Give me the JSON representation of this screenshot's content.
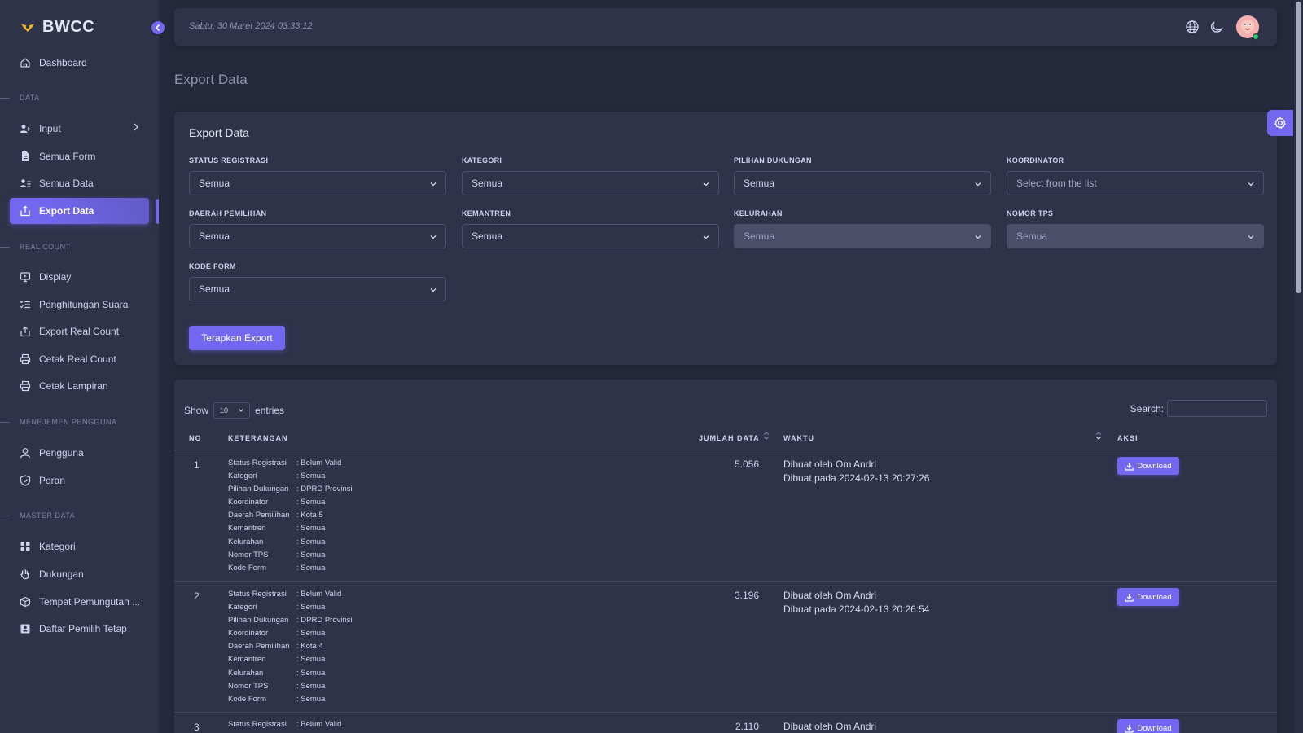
{
  "brand": {
    "name": "BWCC"
  },
  "sidebar": {
    "items": [
      {
        "label": "Dashboard",
        "icon": "home-icon"
      },
      {
        "label": "Input",
        "icon": "user-plus-icon"
      },
      {
        "label": "Semua Form",
        "icon": "file-icon"
      },
      {
        "label": "Semua Data",
        "icon": "users-list-icon"
      },
      {
        "label": "Export Data",
        "icon": "export-icon"
      },
      {
        "label": "Display",
        "icon": "monitor-icon"
      },
      {
        "label": "Penghitungan Suara",
        "icon": "list-check-icon"
      },
      {
        "label": "Export Real Count",
        "icon": "export-icon"
      },
      {
        "label": "Cetak Real Count",
        "icon": "printer-icon"
      },
      {
        "label": "Cetak Lampiran",
        "icon": "printer-icon"
      },
      {
        "label": "Pengguna",
        "icon": "user-icon"
      },
      {
        "label": "Peran",
        "icon": "shield-icon"
      },
      {
        "label": "Kategori",
        "icon": "grid-icon"
      },
      {
        "label": "Dukungan",
        "icon": "hand-icon"
      },
      {
        "label": "Tempat Pemungutan ...",
        "icon": "box-icon"
      },
      {
        "label": "Daftar Pemilih Tetap",
        "icon": "id-card-icon"
      }
    ],
    "sections": [
      "DATA",
      "REAL COUNT",
      "MENEJEMEN PENGGUNA",
      "MASTER DATA"
    ]
  },
  "topbar": {
    "datetime": "Sabtu, 30 Maret 2024  03:33:12"
  },
  "page": {
    "title": "Export Data"
  },
  "filter": {
    "title": "Export Data",
    "fields": [
      {
        "label": "STATUS REGISTRASI",
        "value": "Semua"
      },
      {
        "label": "KATEGORI",
        "value": "Semua"
      },
      {
        "label": "PILIHAN DUKUNGAN",
        "value": "Semua"
      },
      {
        "label": "KOORDINATOR",
        "value": "Select from the list"
      },
      {
        "label": "DAERAH PEMILIHAN",
        "value": "Semua"
      },
      {
        "label": "KEMANTREN",
        "value": "Semua"
      },
      {
        "label": "KELURAHAN",
        "value": "Semua"
      },
      {
        "label": "NOMOR TPS",
        "value": "Semua"
      },
      {
        "label": "KODE FORM",
        "value": "Semua"
      }
    ],
    "submit_label": "Terapkan Export"
  },
  "table": {
    "show_label": "Show",
    "length_value": "10",
    "entries_label": "entries",
    "search_label": "Search:",
    "columns": [
      "NO",
      "KETERANGAN",
      "JUMLAH DATA",
      "WAKTU",
      "AKSI"
    ],
    "download_label": "Download",
    "rows": [
      {
        "no": "1",
        "desc": [
          [
            "Status Registrasi",
            ": Belum Valid"
          ],
          [
            "Kategori",
            ": Semua"
          ],
          [
            "Pilihan Dukungan",
            ": DPRD Provinsi"
          ],
          [
            "Koordinator",
            ": Semua"
          ],
          [
            "Daerah Pemilihan",
            ": Kota 5"
          ],
          [
            "Kemantren",
            ": Semua"
          ],
          [
            "Kelurahan",
            ": Semua"
          ],
          [
            "Nomor TPS",
            ": Semua"
          ],
          [
            "Kode Form",
            ": Semua"
          ]
        ],
        "jumlah": "5.056",
        "created_by": "Dibuat oleh Om Andri",
        "created_at": "Dibuat pada 2024-02-13 20:27:26"
      },
      {
        "no": "2",
        "desc": [
          [
            "Status Registrasi",
            ": Belum Valid"
          ],
          [
            "Kategori",
            ": Semua"
          ],
          [
            "Pilihan Dukungan",
            ": DPRD Provinsi"
          ],
          [
            "Koordinator",
            ": Semua"
          ],
          [
            "Daerah Pemilihan",
            ": Kota 4"
          ],
          [
            "Kemantren",
            ": Semua"
          ],
          [
            "Kelurahan",
            ": Semua"
          ],
          [
            "Nomor TPS",
            ": Semua"
          ],
          [
            "Kode Form",
            ": Semua"
          ]
        ],
        "jumlah": "3.196",
        "created_by": "Dibuat oleh Om Andri",
        "created_at": "Dibuat pada 2024-02-13 20:26:54"
      },
      {
        "no": "3",
        "desc": [
          [
            "Status Registrasi",
            ": Belum Valid"
          ]
        ],
        "jumlah": "2.110",
        "created_by": "Dibuat oleh Om Andri",
        "created_at": ""
      }
    ]
  },
  "colors": {
    "accent": "#7367f0",
    "background": "#25293c",
    "card": "#2f3349",
    "online": "#28c76f"
  }
}
